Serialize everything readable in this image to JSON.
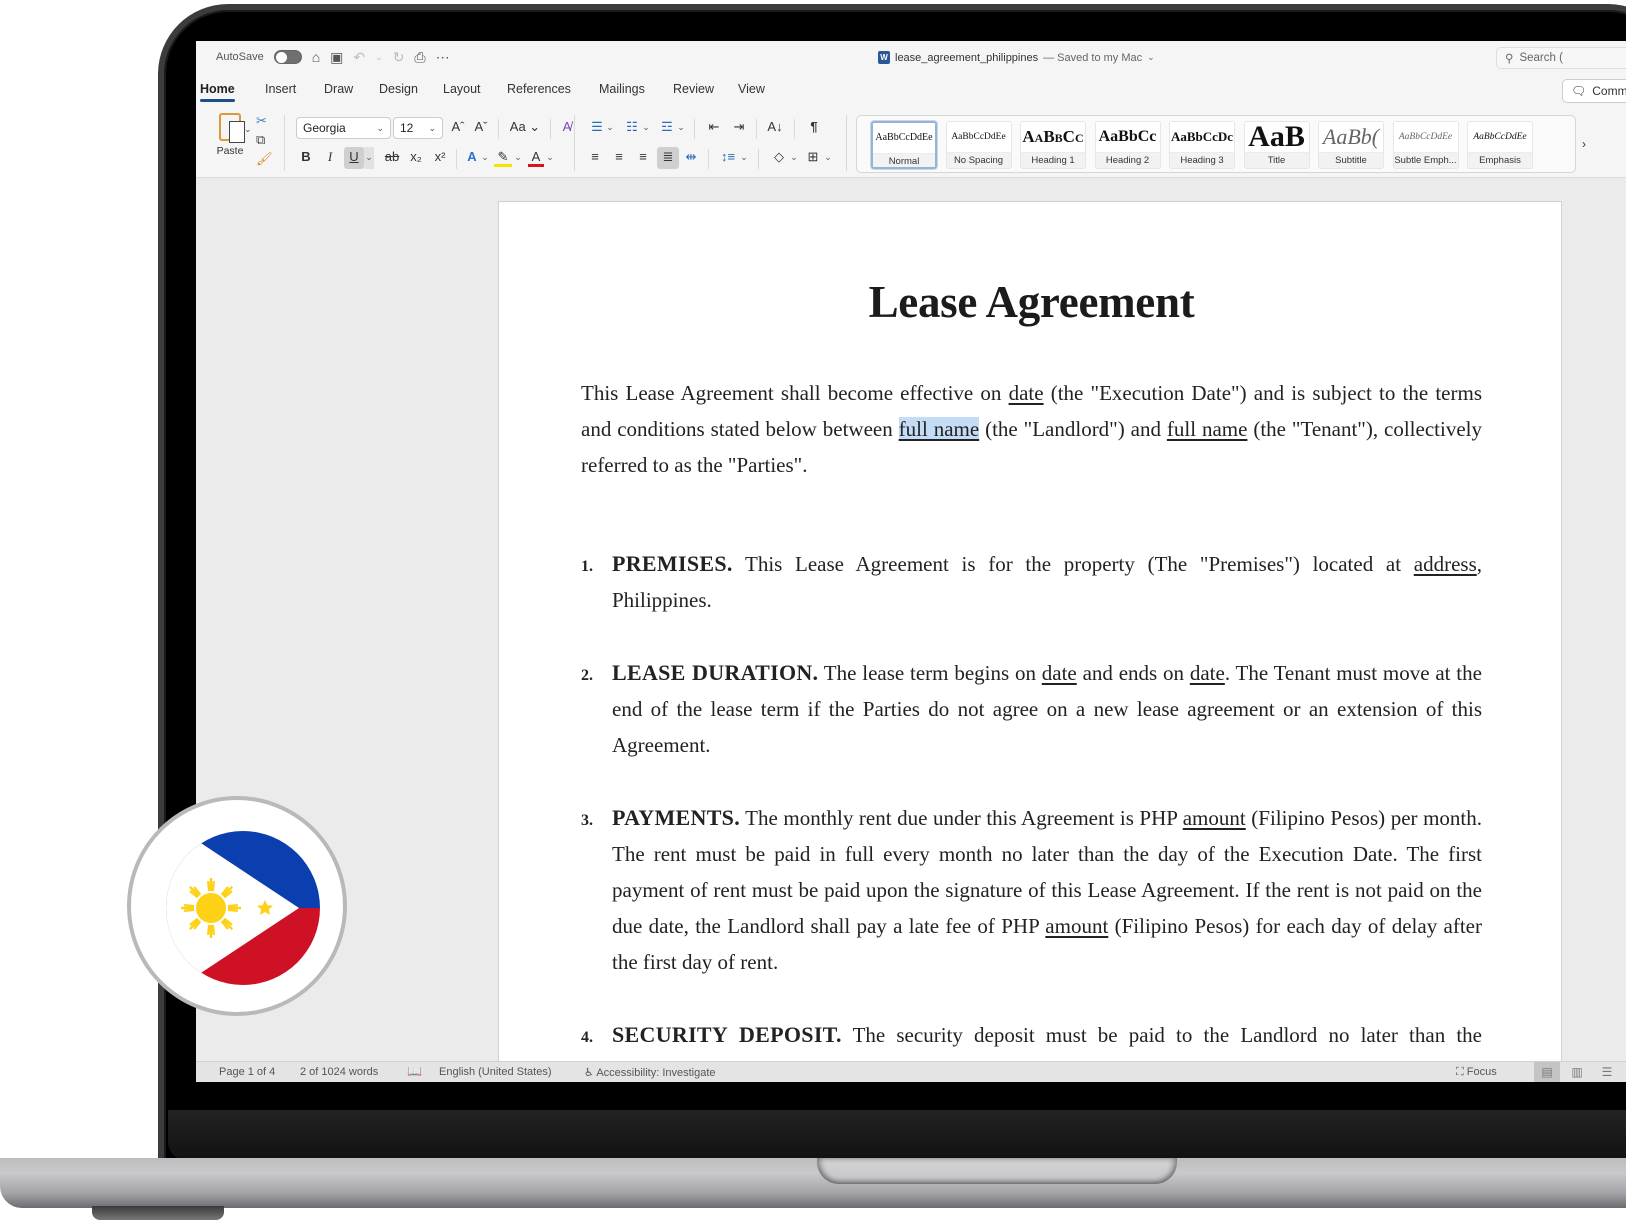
{
  "window": {
    "autosave_label": "AutoSave",
    "autosave_on": false,
    "doc_name": "lease_agreement_philippines",
    "save_status": "— Saved to my Mac",
    "search_placeholder": "Search (",
    "comments_label": "Comm"
  },
  "tabs": [
    {
      "label": "Home",
      "active": true
    },
    {
      "label": "Insert"
    },
    {
      "label": "Draw"
    },
    {
      "label": "Design"
    },
    {
      "label": "Layout"
    },
    {
      "label": "References"
    },
    {
      "label": "Mailings"
    },
    {
      "label": "Review"
    },
    {
      "label": "View"
    }
  ],
  "ribbon": {
    "paste_label": "Paste",
    "font_name": "Georgia",
    "font_size": "12",
    "styles": [
      {
        "sample": "AaBbCcDdEe",
        "name": "Normal",
        "selected": true
      },
      {
        "sample": "AaBbCcDdEe",
        "name": "No Spacing"
      },
      {
        "sample": "AaBbCc",
        "name": "Heading 1"
      },
      {
        "sample": "AaBbCc",
        "name": "Heading 2"
      },
      {
        "sample": "AaBbCcDc",
        "name": "Heading 3"
      },
      {
        "sample": "AaB",
        "name": "Title"
      },
      {
        "sample": "AaBb(",
        "name": "Subtitle"
      },
      {
        "sample": "AaBbCcDdEe",
        "name": "Subtle Emph..."
      },
      {
        "sample": "AaBbCcDdEe",
        "name": "Emphasis"
      }
    ],
    "colors": {
      "highlight": "#f5e400",
      "font_color": "#d9141e",
      "accent": "#1f4e8c"
    }
  },
  "document": {
    "title": "Lease Agreement",
    "intro": {
      "t1": "This Lease Agreement shall become effective on ",
      "f1": "date",
      "t2": " (the \"Execution Date\") and is subject to the terms and conditions stated below between ",
      "f2": "full name",
      "t3": " (the \"Landlord\") and ",
      "f3": "full name",
      "t4": " (the \"Tenant\"), collectively referred to as the \"Parties\"."
    },
    "clauses": [
      {
        "num": "1.",
        "heading": "PREMISES.",
        "t1": " This Lease Agreement is for the property (The \"Premises\") located at ",
        "f1": "address",
        "t2": ", Philippines."
      },
      {
        "num": "2.",
        "heading": "LEASE DURATION.",
        "t1": " The lease term begins on ",
        "f1": "date",
        "t2": " and ends on ",
        "f2": "date",
        "t3": ". The Tenant must move at the end of the lease term if the Parties do not agree on a new lease agreement or an extension of this Agreement."
      },
      {
        "num": "3.",
        "heading": "PAYMENTS.",
        "t1": " The monthly rent due under this Agreement is PHP ",
        "f1": "amount",
        "t2": " (Filipino Pesos) per month. The rent must be paid in full every month no later than the day of the Execution Date. The first payment of rent must be paid upon the signature of this Lease Agreement. If the rent is not paid on the due date, the Landlord shall pay a late fee of PHP ",
        "f2": "amount",
        "t3": " (Filipino Pesos) for each day of delay after the first day of rent."
      },
      {
        "num": "4.",
        "heading": "SECURITY DEPOSIT.",
        "t1": " The security deposit must be paid to the Landlord no later than the Execution Date of this Lease Agreement by the Tenant. The Landlord will hold it as security to"
      }
    ]
  },
  "statusbar": {
    "page": "Page 1 of 4",
    "words": "2 of 1024 words",
    "language": "English (United States)",
    "accessibility": "Accessibility: Investigate",
    "focus": "Focus"
  },
  "badge": {
    "country": "Philippines",
    "colors": {
      "blue": "#0b3fb0",
      "red": "#cf1126",
      "gold": "#fcd116"
    }
  }
}
